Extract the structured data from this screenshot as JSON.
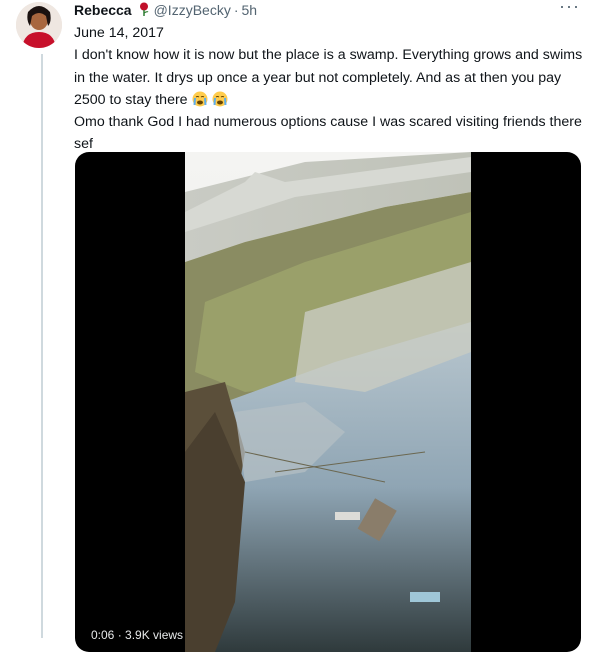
{
  "tweet": {
    "author_name": "Rebecca",
    "author_badge": "rose-emoji",
    "handle": "@IzzyBecky",
    "separator": "·",
    "time": "5h",
    "more_label": "···",
    "lines": [
      "June 14, 2017",
      "I don't know how it is now but the place is a swamp. Everything grows and swims in the water. It drys up once a year but not completely. And as at then you pay 2500 to stay there"
    ],
    "line3": "Omo thank God I had numerous options cause I was scared visiting friends there sef",
    "emoji": "crying-emoji"
  },
  "video": {
    "overlay": "0:06 · 3.9K views",
    "subject": "flooded swampy lot beside a concrete fence"
  },
  "colors": {
    "text": "#0f1419",
    "muted": "#536471",
    "thread_line": "#cfd9de",
    "media_bg": "#000000"
  }
}
